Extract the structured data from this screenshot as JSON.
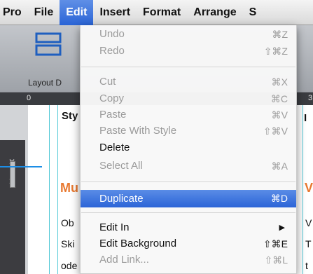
{
  "menubar": {
    "items": [
      {
        "label": "Pro"
      },
      {
        "label": "File"
      },
      {
        "label": "Edit"
      },
      {
        "label": "Insert"
      },
      {
        "label": "Format"
      },
      {
        "label": "Arrange"
      },
      {
        "label": "S"
      }
    ]
  },
  "toolbar": {
    "layout_label": "Layout  D"
  },
  "ruler": {
    "zero": "0",
    "three": "3"
  },
  "background": {
    "heading_left": "Sty",
    "heading_right": "I",
    "red_left": "Mu",
    "red_right": "V",
    "line1": "Ob",
    "line2": "Ski",
    "line3": "ode",
    "r1": "V",
    "r2": "T",
    "r3": "t"
  },
  "edit_menu": {
    "undo": {
      "label": "Undo",
      "shortcut": "⌘Z"
    },
    "redo": {
      "label": "Redo",
      "shortcut": "⇧⌘Z"
    },
    "cut": {
      "label": "Cut",
      "shortcut": "⌘X"
    },
    "copy": {
      "label": "Copy",
      "shortcut": "⌘C"
    },
    "paste": {
      "label": "Paste",
      "shortcut": "⌘V"
    },
    "paste_with_style": {
      "label": "Paste With Style",
      "shortcut": "⇧⌘V"
    },
    "delete": {
      "label": "Delete"
    },
    "select_all": {
      "label": "Select All",
      "shortcut": "⌘A"
    },
    "duplicate": {
      "label": "Duplicate",
      "shortcut": "⌘D"
    },
    "edit_in": {
      "label": "Edit In",
      "arrow": "▶"
    },
    "edit_background": {
      "label": "Edit Background",
      "shortcut": "⇧⌘E"
    },
    "add_link": {
      "label": "Add Link...",
      "shortcut": "⇧⌘L"
    }
  },
  "colors": {
    "highlight": "#2b64d7",
    "accent_orange": "#e8782f",
    "guide_cyan": "#53c9d6"
  },
  "icons": {
    "layout": "layout-icon",
    "close": "close-icon"
  }
}
